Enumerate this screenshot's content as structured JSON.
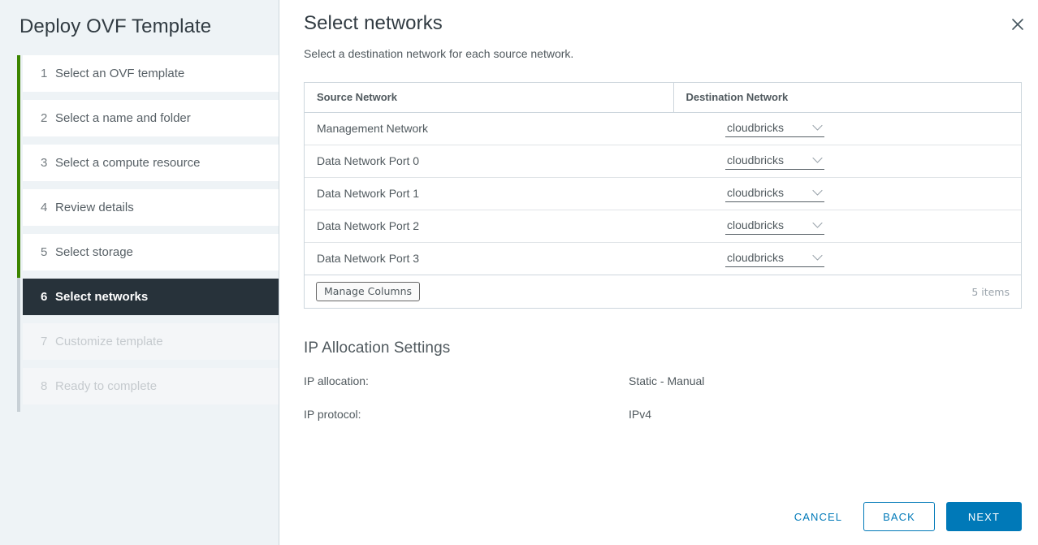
{
  "wizard": {
    "title": "Deploy OVF Template",
    "steps": [
      {
        "num": "1",
        "label": "Select an OVF template",
        "state": "done"
      },
      {
        "num": "2",
        "label": "Select a name and folder",
        "state": "done"
      },
      {
        "num": "3",
        "label": "Select a compute resource",
        "state": "done"
      },
      {
        "num": "4",
        "label": "Review details",
        "state": "done"
      },
      {
        "num": "5",
        "label": "Select storage",
        "state": "done"
      },
      {
        "num": "6",
        "label": "Select networks",
        "state": "active"
      },
      {
        "num": "7",
        "label": "Customize template",
        "state": "disabled"
      },
      {
        "num": "8",
        "label": "Ready to complete",
        "state": "disabled"
      }
    ]
  },
  "main": {
    "title": "Select networks",
    "subtitle": "Select a destination network for each source network.",
    "close_icon": "close-icon"
  },
  "table": {
    "columns": [
      "Source Network",
      "Destination Network"
    ],
    "rows": [
      {
        "source": "Management Network",
        "destination": "cloudbricks"
      },
      {
        "source": "Data Network Port 0",
        "destination": "cloudbricks"
      },
      {
        "source": "Data Network Port 1",
        "destination": "cloudbricks"
      },
      {
        "source": "Data Network Port 2",
        "destination": "cloudbricks"
      },
      {
        "source": "Data Network Port 3",
        "destination": "cloudbricks"
      }
    ],
    "manage_columns_label": "Manage Columns",
    "items_count": "5 items",
    "chevron_icon": "chevron-down-icon"
  },
  "ip_allocation": {
    "heading": "IP Allocation Settings",
    "rows": [
      {
        "key": "IP allocation:",
        "value": "Static - Manual"
      },
      {
        "key": "IP protocol:",
        "value": "IPv4"
      }
    ]
  },
  "footer": {
    "cancel": "CANCEL",
    "back": "BACK",
    "next": "NEXT"
  },
  "colors": {
    "accent": "#0079b8",
    "progress_done": "#3c8500",
    "progress_todo": "#c8d0d6",
    "active_step_bg": "#27323a",
    "sidebar_bg": "#eef3f6"
  }
}
